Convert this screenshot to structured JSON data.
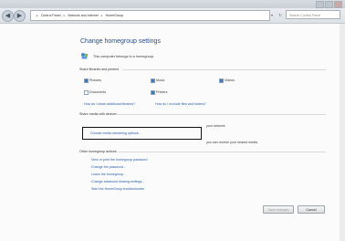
{
  "address": {
    "crumbs": [
      "Control Panel",
      "Network and Internet",
      "HomeGroup"
    ],
    "search_placeholder": "Search Control Panel"
  },
  "page": {
    "title": "Change homegroup settings",
    "status": "This computer belongs to a homegroup."
  },
  "share": {
    "heading": "Share libraries and printers",
    "items": [
      {
        "label": "Pictures",
        "checked": true
      },
      {
        "label": "Music",
        "checked": true
      },
      {
        "label": "Videos",
        "checked": true
      },
      {
        "label": "Documents",
        "checked": false
      },
      {
        "label": "Printers",
        "checked": true
      }
    ],
    "links": [
      "How do I share additional libraries?",
      "How do I exclude files and folders?"
    ]
  },
  "media": {
    "heading": "Share media with devices",
    "right_text_1": "your network",
    "choose_link": "Choose media streaming options...",
    "right_text_2": "you can receive your shared media."
  },
  "other": {
    "heading": "Other homegroup actions",
    "links": [
      "View or print the homegroup password",
      "Change the password...",
      "Leave the homegroup...",
      "Change advanced sharing settings...",
      "Start the HomeGroup troubleshooter"
    ]
  },
  "buttons": {
    "save": "Save changes",
    "cancel": "Cancel"
  },
  "icons": {
    "back": "back-arrow-icon",
    "forward": "forward-arrow-icon",
    "homegroup": "homegroup-icon"
  }
}
